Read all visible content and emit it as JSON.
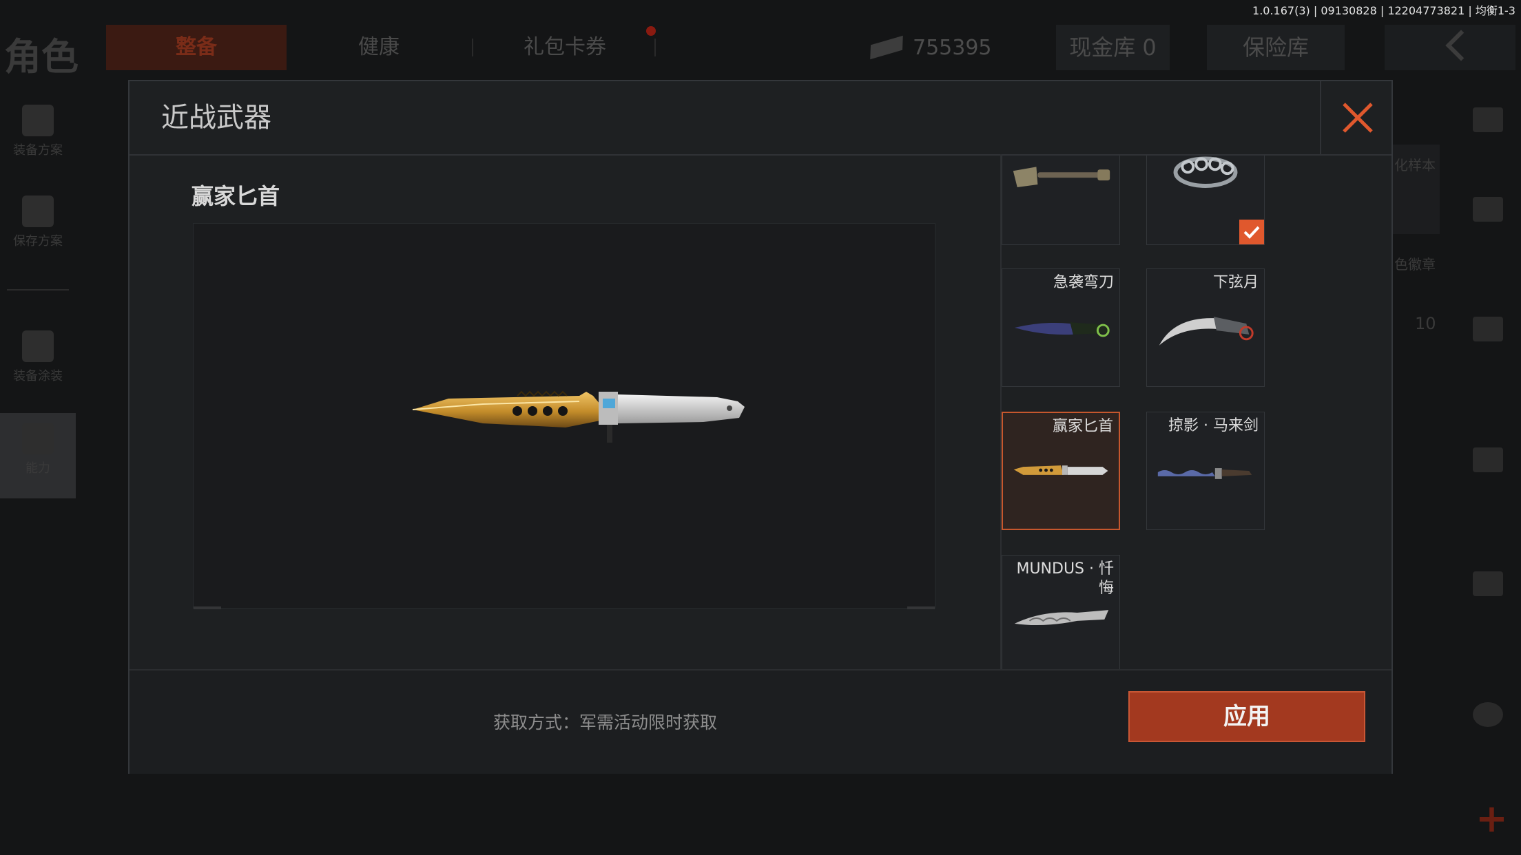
{
  "status_bar": {
    "version": "1.0.167(3) | 09130828 | 12204773821 | 均衡1-3"
  },
  "topbar": {
    "page_title": "角色",
    "tabs": [
      {
        "label": "整备",
        "active": true
      },
      {
        "label": "健康",
        "active": false
      },
      {
        "label": "礼包卡券",
        "active": false
      }
    ],
    "currency_value": "755395",
    "cash_vault": "现金库 0",
    "safe_box": "保险库"
  },
  "left_nav": [
    {
      "label": "装备方案",
      "icon": "armor-vest-icon"
    },
    {
      "label": "保存方案",
      "icon": "download-icon"
    },
    {
      "label": "装备涂装",
      "icon": "helmet-icon"
    },
    {
      "label": "能力",
      "icon": "lightning-icon"
    }
  ],
  "right_side": {
    "label_1": "化样本",
    "label_2": "色徽章",
    "count": "10",
    "icons": [
      "stack-icon",
      "home-icon",
      "wrench-icon",
      "ticket-icon",
      "map-icon",
      "clock-icon",
      "plus-icon"
    ]
  },
  "modal": {
    "title": "近战武器",
    "preview_name": "赢家匕首",
    "items": [
      {
        "name": "",
        "art": "shovel",
        "equipped": false,
        "selected": false
      },
      {
        "name": "",
        "art": "knuckles",
        "equipped": true,
        "selected": false
      },
      {
        "name": "急袭弯刀",
        "art": "curved-knife",
        "equipped": false,
        "selected": false
      },
      {
        "name": "下弦月",
        "art": "karambit",
        "equipped": false,
        "selected": false
      },
      {
        "name": "赢家匕首",
        "art": "gold-dagger",
        "equipped": false,
        "selected": true
      },
      {
        "name": "掠影 · 马来剑",
        "art": "kris",
        "equipped": false,
        "selected": false
      },
      {
        "name": "MUNDUS · 忏悔",
        "art": "silver-blade",
        "equipped": false,
        "selected": false
      }
    ],
    "obtain_text": "获取方式：军需活动限时获取",
    "apply_label": "应用",
    "accent_color": "#c6572d"
  }
}
